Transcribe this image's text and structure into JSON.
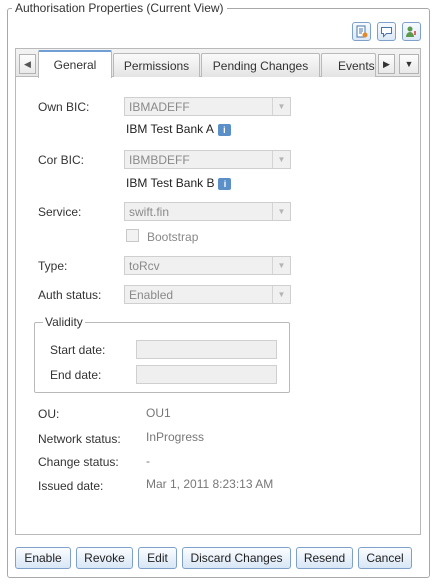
{
  "window": {
    "title": "Authorisation Properties (Current View)"
  },
  "toolbar": {
    "icons": [
      "document-edit-icon",
      "comment-icon",
      "user-alert-icon"
    ]
  },
  "tabs": {
    "items": [
      {
        "label": "General",
        "active": true
      },
      {
        "label": "Permissions",
        "active": false
      },
      {
        "label": "Pending Changes",
        "active": false
      },
      {
        "label": "Events",
        "active": false
      }
    ]
  },
  "form": {
    "own_bic": {
      "label": "Own BIC:",
      "value": "IBMADEFF",
      "bank_name": "IBM Test Bank A"
    },
    "cor_bic": {
      "label": "Cor BIC:",
      "value": "IBMBDEFF",
      "bank_name": "IBM Test Bank B"
    },
    "service": {
      "label": "Service:",
      "value": "swift.fin"
    },
    "bootstrap": {
      "label": "Bootstrap",
      "checked": false
    },
    "type": {
      "label": "Type:",
      "value": "toRcv"
    },
    "auth_status": {
      "label": "Auth status:",
      "value": "Enabled"
    },
    "validity": {
      "legend": "Validity",
      "start_label": "Start date:",
      "start_value": "",
      "end_label": "End date:",
      "end_value": ""
    },
    "ou": {
      "label": "OU:",
      "value": "OU1"
    },
    "network_status": {
      "label": "Network status:",
      "value": "InProgress"
    },
    "change_status": {
      "label": "Change status:",
      "value": "-"
    },
    "issued_date": {
      "label": "Issued date:",
      "value": "Mar 1, 2011 8:23:13 AM"
    }
  },
  "buttons": {
    "enable": "Enable",
    "revoke": "Revoke",
    "edit": "Edit",
    "discard": "Discard Changes",
    "resend": "Resend",
    "cancel": "Cancel"
  },
  "colors": {
    "accent": "#6f9fd4",
    "button_border": "#7fa1c9",
    "disabled_field": "#f0f0f0"
  }
}
